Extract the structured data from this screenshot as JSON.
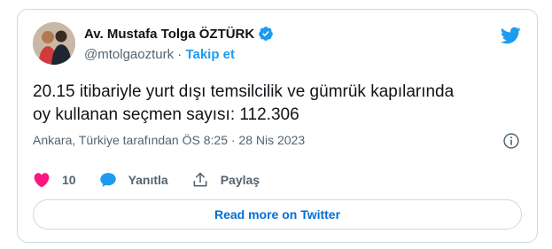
{
  "author": {
    "display_name": "Av. Mustafa Tolga ÖZTÜRK",
    "handle": "@mtolgaozturk",
    "separator": "·",
    "follow_label": "Takip et",
    "verified_icon": "verified-badge-icon"
  },
  "tweet": {
    "text_line1": "20.15 itibariyle yurt dışı temsilcilik ve gümrük kapılarında",
    "text_line2": "oy kullanan seçmen sayısı: 112.306"
  },
  "meta": {
    "location_time": "Ankara, Türkiye tarafından ÖS 8:25 · 28 Nis 2023"
  },
  "actions": {
    "like_count": "10",
    "reply_label": "Yanıtla",
    "share_label": "Paylaş"
  },
  "read_more_label": "Read more on Twitter",
  "colors": {
    "brand": "#1d9bf0",
    "like": "#f91880",
    "text": "#0f1419",
    "muted": "#536471",
    "border": "#cfd9de"
  }
}
